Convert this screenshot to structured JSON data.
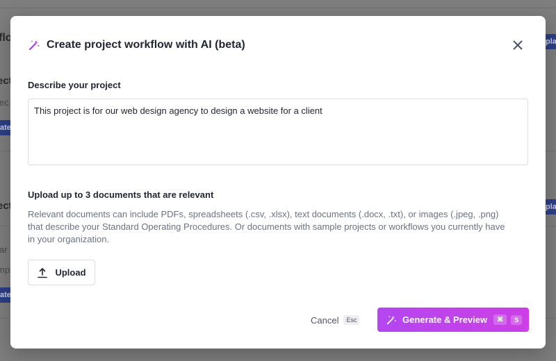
{
  "background": {
    "fragments": [
      {
        "text": "flo"
      },
      {
        "text": "ect"
      },
      {
        "text": "jec"
      },
      {
        "text": "ate"
      },
      {
        "text": "ect"
      },
      {
        "text": "lar"
      },
      {
        "text": "mpl"
      },
      {
        "text": "ate"
      },
      {
        "text": "plat"
      },
      {
        "text": "plat"
      }
    ]
  },
  "modal": {
    "title": "Create project workflow with AI (beta)",
    "title_icon": "magic-wand-icon",
    "close_icon": "close-icon",
    "describe_label": "Describe your project",
    "describe_value": "This project is for our web design agency to design a website for a client",
    "upload_label": "Upload up to 3 documents that are relevant",
    "upload_help": "Relevant documents can include PDFs, spreadsheets (.csv, .xlsx), text documents (.docx, .txt), or images (.jpeg, .png) that describe your Standard Operating Procedures. Or documents with sample projects or workflows you currently have in your organization.",
    "upload_button": "Upload",
    "upload_icon": "upload-icon",
    "cancel_label": "Cancel",
    "cancel_shortcut": "Esc",
    "generate_label": "Generate & Preview",
    "generate_icon": "magic-wand-icon",
    "generate_shortcut_mod": "⌘",
    "generate_shortcut_key": "S"
  },
  "colors": {
    "accent_start": "#b446f0",
    "accent_end": "#cc3fe6",
    "background_button": "#2d3f86"
  }
}
